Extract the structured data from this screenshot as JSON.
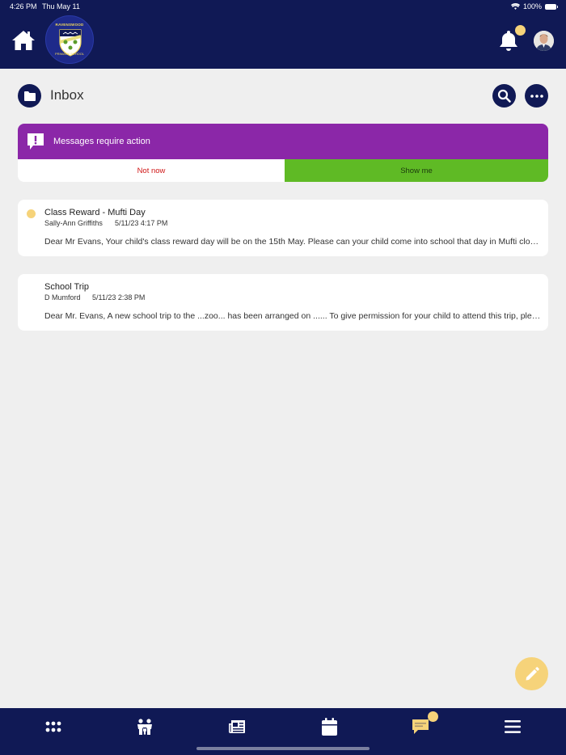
{
  "status_bar": {
    "time": "4:26 PM",
    "date": "Thu May 11",
    "battery": "100%"
  },
  "logo": {
    "top_text": "RAVENSWOOD",
    "bottom_text": "PRIMARY SCHOOL"
  },
  "page": {
    "title": "Inbox"
  },
  "action_banner": {
    "message": "Messages require action",
    "not_now_label": "Not now",
    "show_me_label": "Show me",
    "color": "#8b27a8"
  },
  "messages": [
    {
      "subject": "Class Reward - Mufti Day",
      "sender": "Sally-Ann Griffiths",
      "date": "5/11/23 4:17 PM",
      "preview": "Dear Mr Evans, Your child's class reward day will be on the 15th May. Please can your child come into school that day in Mufti clothes.",
      "unread": true
    },
    {
      "subject": "School Trip",
      "sender": "D Mumford",
      "date": "5/11/23 2:38 PM",
      "preview": "Dear Mr. Evans, A new school trip to the ...zoo... has been arranged on ...... To give permission for your child to attend this trip, please click the link.",
      "unread": false
    }
  ],
  "colors": {
    "navy": "#101955",
    "accent_yellow": "#f6d37a",
    "show_me_green": "#5fba25",
    "not_now_red": "#d01818"
  }
}
